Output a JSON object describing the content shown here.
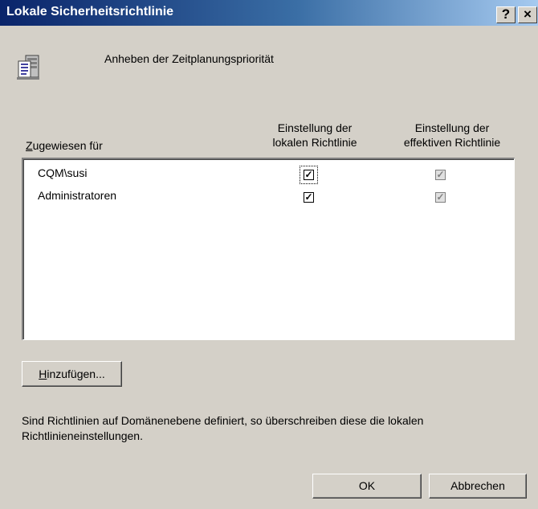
{
  "window": {
    "title": "Lokale Sicherheitsrichtlinie",
    "help_label": "?",
    "close_label": "×"
  },
  "policy": {
    "name": "Anheben der Zeitplanungspriorität",
    "icon": "policy-server-icon"
  },
  "columns": {
    "assigned_to": "Zugewiesen für",
    "local_line1": "Einstellung der",
    "local_line2": "lokalen Richtlinie",
    "effective_line1": "Einstellung der",
    "effective_line2": "effektiven Richtlinie"
  },
  "entries": [
    {
      "name": "CQM\\susi",
      "local": true,
      "effective": true
    },
    {
      "name": "Administratoren",
      "local": true,
      "effective": true
    }
  ],
  "buttons": {
    "add_prefix": "H",
    "add_rest": "inzufügen...",
    "ok": "OK",
    "cancel": "Abbrechen"
  },
  "note": "Sind Richtlinien auf Domänenebene definiert, so überschreiben diese die lokalen Richtlinieneinstellungen."
}
